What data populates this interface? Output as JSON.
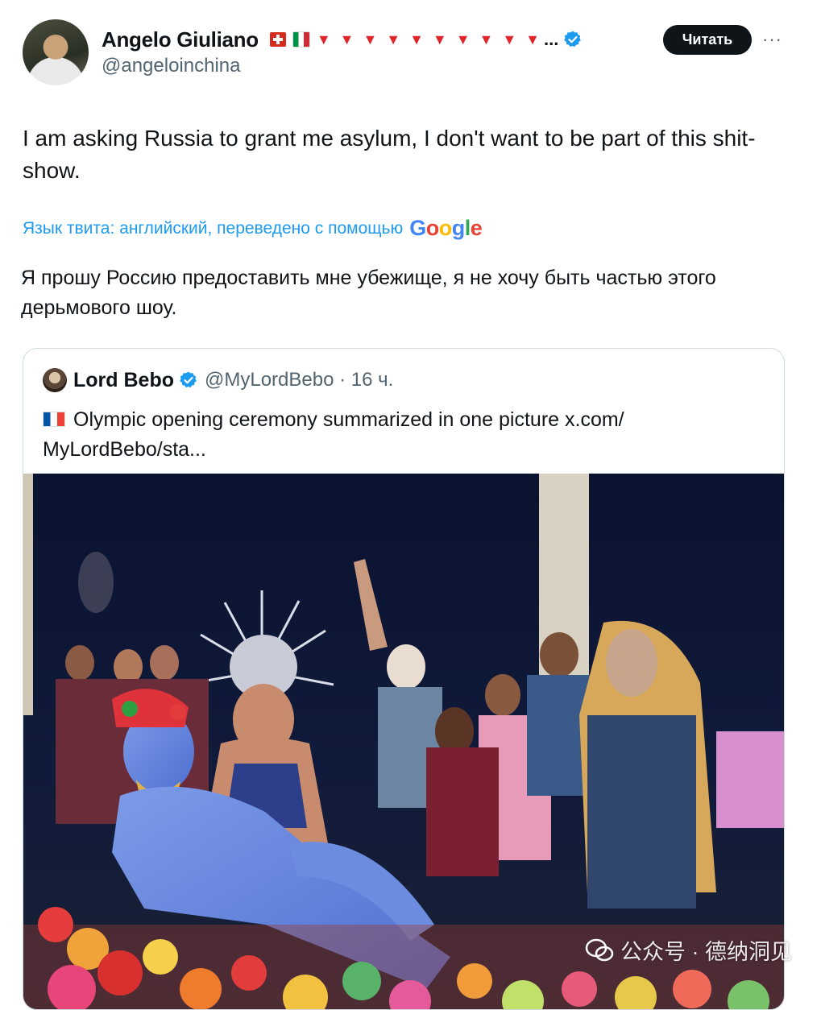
{
  "author": {
    "display_name": "Angelo Giuliano",
    "handle": "@angeloinchina",
    "name_suffix_emoji": "▼▼▼▼▼▼▼▼▼▼",
    "ellipsis": "...",
    "follow_label": "Читать",
    "more_label": "···"
  },
  "tweet": {
    "text": "I am asking Russia to grant me asylum, I don't want to be part of this shit-show.",
    "translation_label": "Язык твита: английский, переведено с помощью",
    "translation_provider": "Google",
    "translated_text": "Я прошу Россию предоставить мне убежище, я не хочу быть частью этого дерьмового шоу."
  },
  "quoted_tweet": {
    "display_name": "Lord Bebo",
    "handle_time": "@MyLordBebo · 16 ч.",
    "text": "Olympic opening ceremony summarized in one picture x.com/ MyLordBebo/sta...",
    "media_description": "photo"
  },
  "watermark": {
    "text": "公众号 · 德纳洞见"
  },
  "colors": {
    "accent": "#1d9bf0",
    "text": "#0f1419",
    "secondary_text": "#536471",
    "border": "#cfd9de",
    "triangle_red": "#e0242b"
  }
}
